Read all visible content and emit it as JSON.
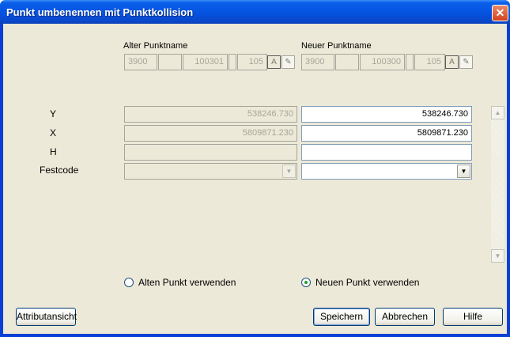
{
  "window": {
    "title": "Punkt umbenennen mit Punktkollision",
    "close_glyph": "✕"
  },
  "headers": {
    "old_name": "Alter Punktname",
    "new_name": "Neuer Punktname"
  },
  "old_point": {
    "part1": "3900",
    "part2": "",
    "part3": "100301",
    "part4": "",
    "part5": "105"
  },
  "new_point": {
    "part1": "3900",
    "part2": "",
    "part3": "100300",
    "part4": "",
    "part5": "105"
  },
  "rows": {
    "y": {
      "label": "Y",
      "old": "538246.730",
      "new": "538246.730"
    },
    "x": {
      "label": "X",
      "old": "5809871.230",
      "new": "5809871.230"
    },
    "h": {
      "label": "H",
      "old": "",
      "new": ""
    },
    "festcode": {
      "label": "Festcode",
      "old": "",
      "new": ""
    }
  },
  "radios": {
    "old": {
      "label": "Alten Punkt verwenden",
      "selected": false
    },
    "new": {
      "label": "Neuen Punkt verwenden",
      "selected": true
    }
  },
  "buttons": {
    "attribute_view": "Attributansicht",
    "save": "Speichern",
    "cancel": "Abbrechen",
    "help": "Hilfe"
  },
  "icons": {
    "pick_a": "A",
    "pick_pen": "✎",
    "arrow_down": "▼",
    "arrow_up": "▲"
  },
  "colors": {
    "title_bar": "#0553e1",
    "dialog_bg": "#ece9d8",
    "close": "#d0431b",
    "button_border": "#003c74"
  }
}
